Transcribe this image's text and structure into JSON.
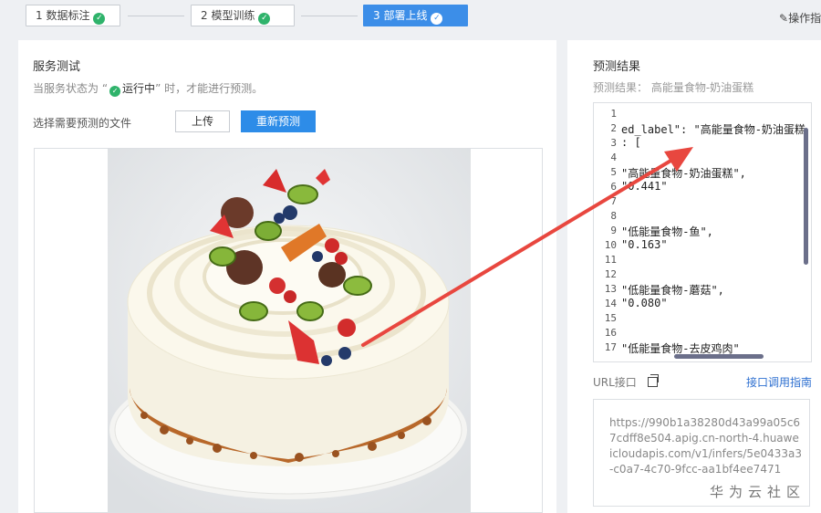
{
  "steps": [
    {
      "label": "1 数据标注"
    },
    {
      "label": "2 模型训练"
    },
    {
      "label": "3 部署上线"
    }
  ],
  "header": {
    "guide": "操作指"
  },
  "service": {
    "title": "服务测试",
    "hint_prefix": "当服务状态为 “",
    "hint_status": "运行中",
    "hint_suffix": "” 时，才能进行预测。",
    "file_label": "选择需要预测的文件",
    "upload_label": "上传",
    "repredict_label": "重新预测"
  },
  "result": {
    "title": "预测结果",
    "summary": "预测结果： 高能量食物-奶油蛋糕",
    "code_lines": [
      {
        "n": "1",
        "text": ""
      },
      {
        "n": "2",
        "text": "ed_label\": \"高能量食物-奶油蛋糕"
      },
      {
        "n": "3",
        "text": ": ["
      },
      {
        "n": "4",
        "text": ""
      },
      {
        "n": "5",
        "text": "\"高能量食物-奶油蛋糕\","
      },
      {
        "n": "6",
        "text": "\"0.441\""
      },
      {
        "n": "7",
        "text": ""
      },
      {
        "n": "8",
        "text": ""
      },
      {
        "n": "9",
        "text": "\"低能量食物-鱼\","
      },
      {
        "n": "10",
        "text": "\"0.163\""
      },
      {
        "n": "11",
        "text": ""
      },
      {
        "n": "12",
        "text": ""
      },
      {
        "n": "13",
        "text": "\"低能量食物-蘑菇\","
      },
      {
        "n": "14",
        "text": "\"0.080\""
      },
      {
        "n": "15",
        "text": ""
      },
      {
        "n": "16",
        "text": ""
      },
      {
        "n": "17",
        "text": "\"低能量食物-去皮鸡肉\""
      }
    ],
    "url_label": "URL接口",
    "api_guide": "接口调用指南",
    "url_value": "https://990b1a38280d43a99a05c67cdff8e504.apig.cn-north-4.huaweicloudapis.com/v1/infers/5e0433a3-c0a7-4c70-9fcc-aa1bf4ee7471"
  },
  "watermark": "华为云社区",
  "colors": {
    "accent": "#2d8ce8",
    "success": "#2fb36b",
    "arrow": "#e8473f"
  },
  "icons": {
    "step_done": "check-circle-icon",
    "copy": "copy-icon"
  }
}
